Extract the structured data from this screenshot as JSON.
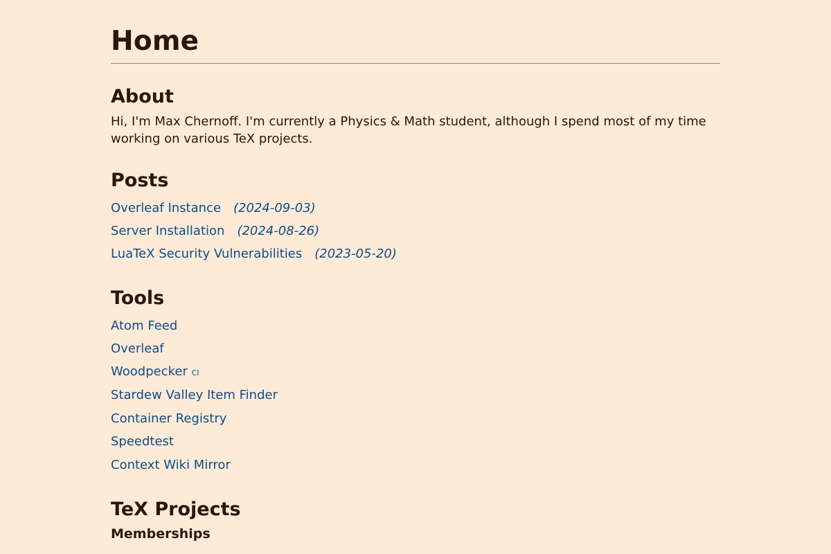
{
  "page": {
    "title": "Home"
  },
  "about": {
    "heading": "About",
    "text": "Hi, I'm Max Chernoff. I'm currently a Physics & Math student, although I spend most of my time working on various TeX projects."
  },
  "posts": {
    "heading": "Posts",
    "items": [
      {
        "title": "Overleaf Instance",
        "date": "(2024-09-03)"
      },
      {
        "title": "Server Installation",
        "date": "(2024-08-26)"
      },
      {
        "title": "LuaTeX Security Vulnerabilities",
        "date": "(2023-05-20)"
      }
    ]
  },
  "tools": {
    "heading": "Tools",
    "items": [
      {
        "label": "Atom Feed"
      },
      {
        "label": "Overleaf"
      },
      {
        "label": "Woodpecker ",
        "suffix": "ci"
      },
      {
        "label": "Stardew Valley Item Finder"
      },
      {
        "label": "Container Registry"
      },
      {
        "label": "Speedtest"
      },
      {
        "label": "Context Wiki Mirror"
      }
    ]
  },
  "tex_projects": {
    "heading": "TeX Projects",
    "memberships_heading": "Memberships"
  },
  "colors": {
    "background": "#fdebd7",
    "text": "#2a170b",
    "link": "#0f4c8a"
  }
}
